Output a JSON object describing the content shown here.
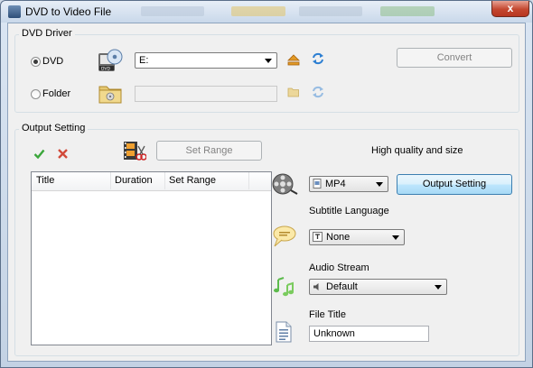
{
  "window": {
    "title": "DVD to Video File",
    "close_glyph": "x"
  },
  "dvd_driver": {
    "group_label": "DVD Driver",
    "dvd_radio_label": "DVD",
    "dvd_selected": true,
    "drive_value": "E:",
    "folder_radio_label": "Folder",
    "folder_path": "",
    "convert_label": "Convert"
  },
  "output_setting": {
    "group_label": "Output Setting",
    "set_range_button": "Set Range",
    "table_columns": [
      "Title",
      "Duration",
      "Set Range"
    ],
    "rows": [],
    "quality_text": "High quality and size",
    "format_value": "MP4",
    "output_setting_button": "Output Setting",
    "subtitle_label": "Subtitle Language",
    "subtitle_value": "None",
    "audio_label": "Audio Stream",
    "audio_value": "Default",
    "file_title_label": "File Title",
    "file_title_value": "Unknown"
  },
  "icons": {
    "accent": "#2d7fd2",
    "eject_color": "#d98a1a",
    "check_color": "#3aa63a",
    "delete_color": "#d24a3a"
  }
}
